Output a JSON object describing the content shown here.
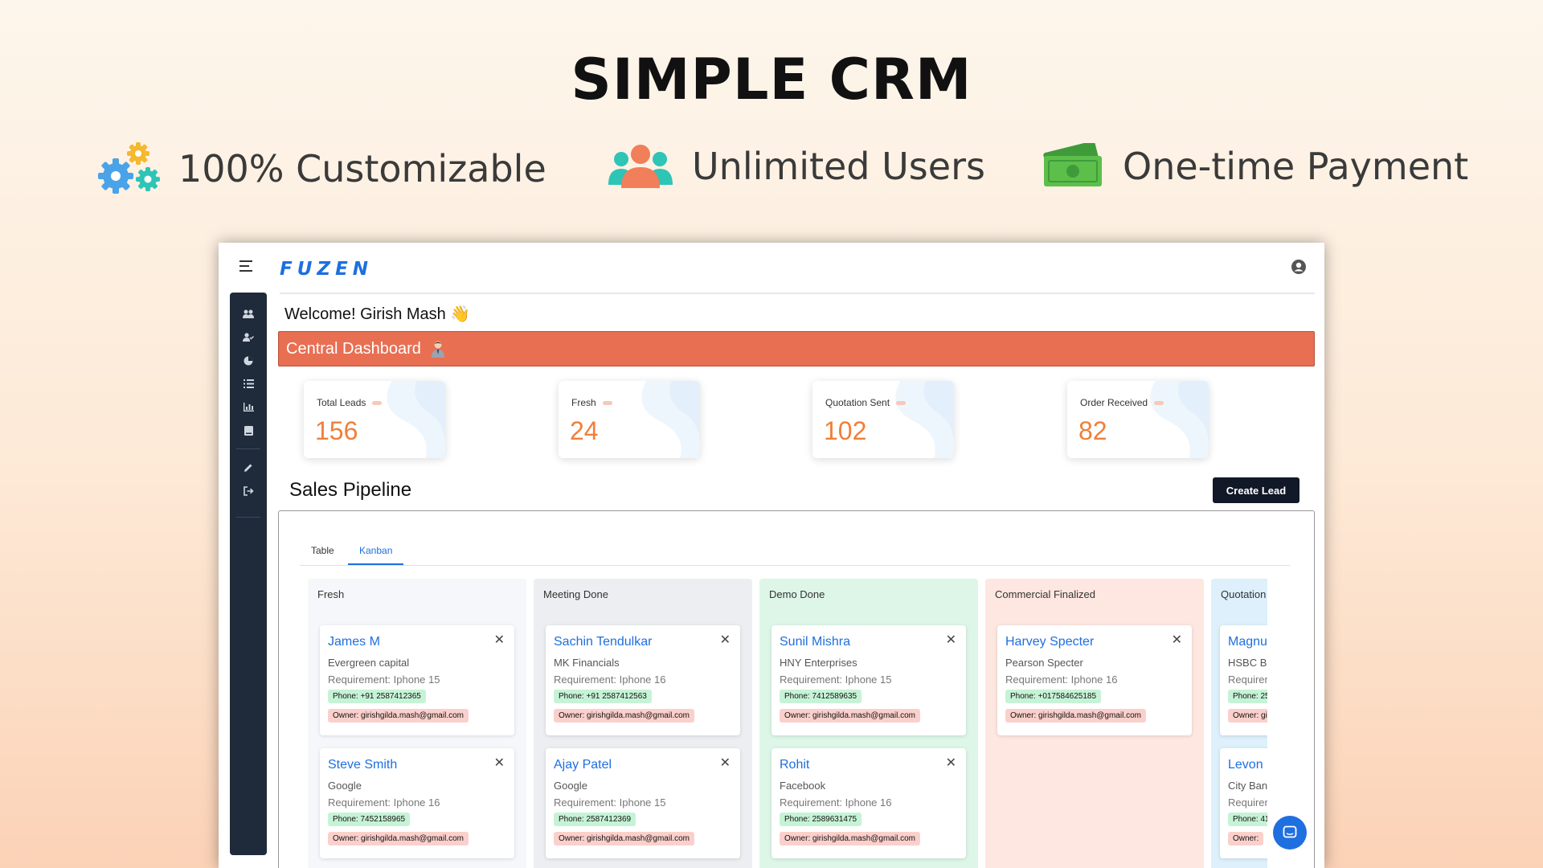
{
  "hero": {
    "title": "SIMPLE CRM",
    "features": [
      {
        "icon": "gears-icon",
        "label": "100% Customizable"
      },
      {
        "icon": "users-icon",
        "label": "Unlimited Users"
      },
      {
        "icon": "money-icon",
        "label": "One-time Payment"
      }
    ]
  },
  "app": {
    "logo": "FUZEN",
    "welcome": "Welcome! Girish Mash 👋",
    "banner": "Central Dashboard",
    "sidebar_icons": [
      "users-icon",
      "user-check-icon",
      "pie-icon",
      "list-icon",
      "chart-icon",
      "book-icon",
      "edit-icon",
      "logout-icon"
    ],
    "stats": [
      {
        "label": "Total Leads",
        "value": "156"
      },
      {
        "label": "Fresh",
        "value": "24"
      },
      {
        "label": "Quotation Sent",
        "value": "102"
      },
      {
        "label": "Order Received",
        "value": "82"
      }
    ],
    "pipeline_title": "Sales Pipeline",
    "create_button": "Create Lead",
    "tabs": [
      {
        "label": "Table"
      },
      {
        "label": "Kanban"
      }
    ],
    "columns": [
      {
        "title": "Fresh",
        "bg": "#f5f7fa",
        "cards": [
          {
            "name": "James M",
            "company": "Evergreen capital",
            "requirement": "Requirement: Iphone 15",
            "phone": "Phone: +91 2587412365",
            "owner": "Owner: girishgilda.mash@gmail.com"
          },
          {
            "name": "Steve Smith",
            "company": "Google",
            "requirement": "Requirement: Iphone 16",
            "phone": "Phone: 7452158965",
            "owner": "Owner: girishgilda.mash@gmail.com"
          }
        ]
      },
      {
        "title": "Meeting Done",
        "bg": "#eceef1",
        "cards": [
          {
            "name": "Sachin Tendulkar",
            "company": "MK Financials",
            "requirement": "Requirement: Iphone 16",
            "phone": "Phone: +91 2587412563",
            "owner": "Owner: girishgilda.mash@gmail.com"
          },
          {
            "name": "Ajay Patel",
            "company": "Google",
            "requirement": "Requirement: Iphone 15",
            "phone": "Phone: 2587412369",
            "owner": "Owner: girishgilda.mash@gmail.com"
          }
        ]
      },
      {
        "title": "Demo Done",
        "bg": "#ddf6e8",
        "cards": [
          {
            "name": "Sunil Mishra",
            "company": "HNY Enterprises",
            "requirement": "Requirement: Iphone 15",
            "phone": "Phone: 7412589635",
            "owner": "Owner: girishgilda.mash@gmail.com"
          },
          {
            "name": "Rohit",
            "company": "Facebook",
            "requirement": "Requirement: Iphone 16",
            "phone": "Phone: 2589631475",
            "owner": "Owner: girishgilda.mash@gmail.com"
          }
        ]
      },
      {
        "title": "Commercial Finalized",
        "bg": "#fde7e0",
        "cards": [
          {
            "name": "Harvey Specter",
            "company": "Pearson Specter",
            "requirement": "Requirement: Iphone 16",
            "phone": "Phone: +017584625185",
            "owner": "Owner: girishgilda.mash@gmail.com"
          }
        ]
      },
      {
        "title": "Quotation",
        "bg": "#ddf0fb",
        "cards": [
          {
            "name": "Magnu",
            "company": "HSBC Ba",
            "requirement": "Requiren",
            "phone": "Phone: 25",
            "owner": "Owner: gi"
          },
          {
            "name": "Levon",
            "company": "City Banl",
            "requirement": "Requiren",
            "phone": "Phone: 41",
            "owner": "Owner:"
          }
        ]
      }
    ]
  },
  "colors": {
    "accent": "#1e6fe0",
    "banner": "#e86f52",
    "stat_number": "#f07f38",
    "sidebar": "#1f2a3a"
  }
}
